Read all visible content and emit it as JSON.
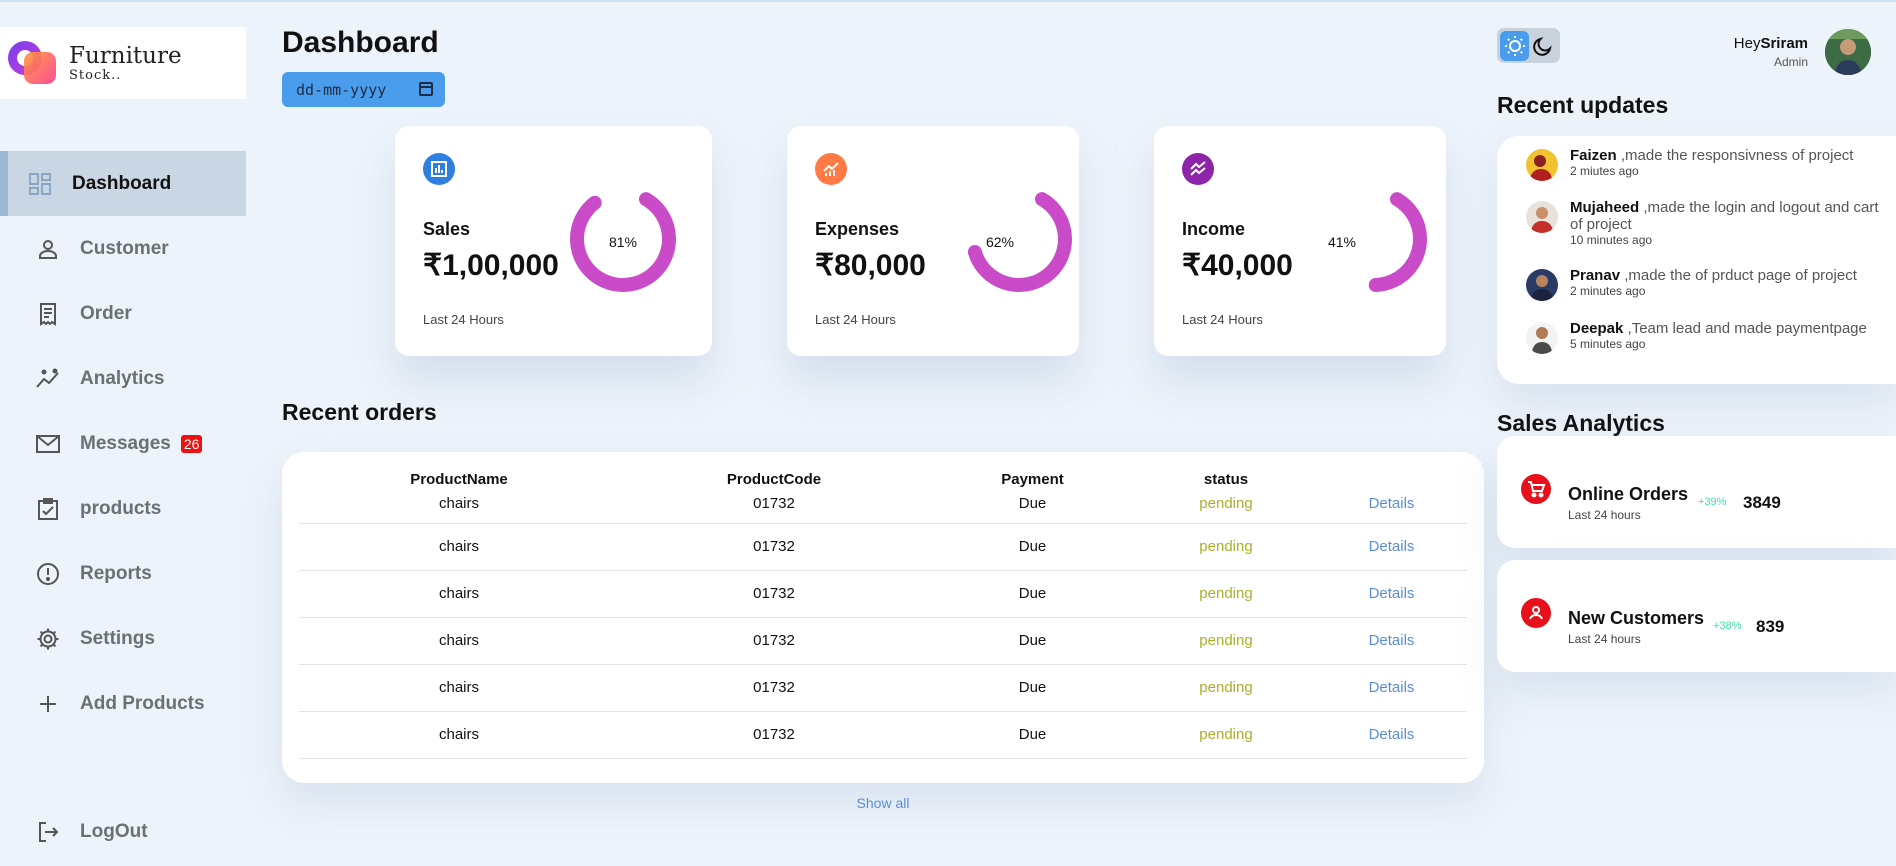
{
  "brand": {
    "title": "Furniture",
    "subtitle": "Stock.."
  },
  "sidebar": {
    "items": [
      {
        "label": "Dashboard",
        "icon": "grid-icon"
      },
      {
        "label": "Customer",
        "icon": "person-icon"
      },
      {
        "label": "Order",
        "icon": "receipt-icon"
      },
      {
        "label": "Analytics",
        "icon": "insights-icon"
      },
      {
        "label": "Messages",
        "icon": "mail-icon",
        "badge": "26"
      },
      {
        "label": "products",
        "icon": "inventory-icon"
      },
      {
        "label": "Reports",
        "icon": "report-icon"
      },
      {
        "label": "Settings",
        "icon": "gear-icon"
      },
      {
        "label": "Add Products",
        "icon": "plus-icon"
      }
    ],
    "logout": "LogOut"
  },
  "main": {
    "title": "Dashboard",
    "date_placeholder": "dd-mm-yyyy",
    "cards": [
      {
        "label": "Sales",
        "amount": "₹1,00,000",
        "percent": "81%",
        "progress": 0.81,
        "foot": "Last 24 Hours",
        "icon_color": "#2f7fe0"
      },
      {
        "label": "Expenses",
        "amount": "₹80,000",
        "percent": "62%",
        "progress": 0.62,
        "foot": "Last 24 Hours",
        "icon_color": "#ff7a45"
      },
      {
        "label": "Income",
        "amount": "₹40,000",
        "percent": "41%",
        "progress": 0.41,
        "foot": "Last 24 Hours",
        "icon_color": "#8e24aa"
      }
    ],
    "ring_color": "#c94bc7",
    "orders": {
      "title": "Recent orders",
      "headers": [
        "ProductName",
        "ProductCode",
        "Payment",
        "status",
        ""
      ],
      "rows": [
        [
          "chairs",
          "01732",
          "Due",
          "pending",
          "Details"
        ],
        [
          "chairs",
          "01732",
          "Due",
          "pending",
          "Details"
        ],
        [
          "chairs",
          "01732",
          "Due",
          "pending",
          "Details"
        ],
        [
          "chairs",
          "01732",
          "Due",
          "pending",
          "Details"
        ],
        [
          "chairs",
          "01732",
          "Due",
          "pending",
          "Details"
        ],
        [
          "chairs",
          "01732",
          "Due",
          "pending",
          "Details"
        ]
      ],
      "show_all": "Show all"
    }
  },
  "profile": {
    "greeting": "Hey",
    "name": "Sriram",
    "role": "Admin"
  },
  "updates": {
    "title": "Recent updates",
    "items": [
      {
        "name": "Faizen",
        "text": " ,made the responsivness of project",
        "time": "2 miutes ago"
      },
      {
        "name": "Mujaheed",
        "text": " ,made the login and logout and cart of project",
        "time": "10 minutes ago"
      },
      {
        "name": "Pranav",
        "text": " ,made the of prduct page of project",
        "time": "2 minutes ago"
      },
      {
        "name": "Deepak",
        "text": " ,Team lead and made paymentpage",
        "time": "5 minutes ago"
      }
    ]
  },
  "analytics": {
    "title": "Sales Analytics",
    "items": [
      {
        "title": "Online Orders",
        "sub": "Last 24 hours",
        "pct": "+39%",
        "value": "3849",
        "icon": "cart-icon"
      },
      {
        "title": "New Customers",
        "sub": "Last 24 hours",
        "pct": "+38%",
        "value": "839",
        "icon": "user-circle-icon"
      }
    ]
  }
}
